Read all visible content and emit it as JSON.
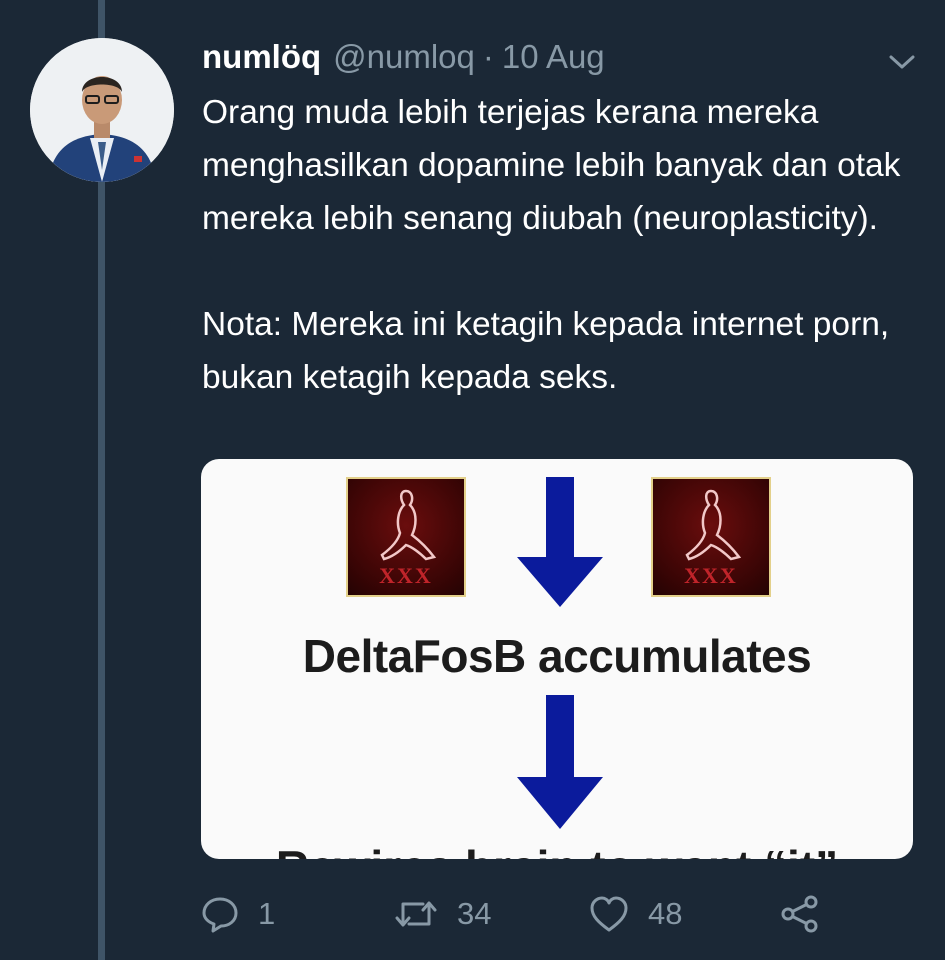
{
  "tweet": {
    "display_name": "numlöq",
    "handle": "@numloq",
    "separator": "·",
    "date": "10 Aug",
    "text_paragraph_1": "Orang muda lebih terjejas kerana mereka menghasilkan dopamine lebih banyak dan otak mereka lebih senang diubah (neuroplasticity).",
    "text_paragraph_2": "Nota: Mereka ini ketagih kepada internet porn, bukan ketagih kepada seks."
  },
  "media": {
    "icon_label": "XXX",
    "caption_1": "DeltaFosB accumulates",
    "caption_2": "Rewires brain to want “it”"
  },
  "actions": {
    "reply_count": "1",
    "retweet_count": "34",
    "like_count": "48"
  },
  "icons": {
    "caret": "chevron-down-icon",
    "reply": "reply-icon",
    "retweet": "retweet-icon",
    "like": "heart-icon",
    "share": "share-icon"
  },
  "colors": {
    "background": "#1b2836",
    "secondary_text": "#8899a6",
    "thread_line": "#3f5467",
    "arrow_blue": "#0b1b9c"
  }
}
